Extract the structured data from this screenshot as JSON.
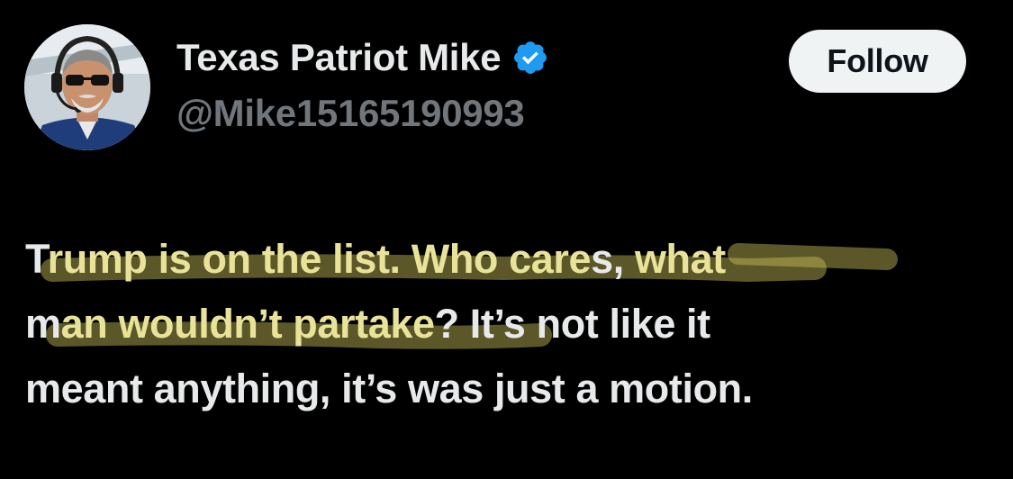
{
  "author": {
    "display_name": "Texas Patriot Mike",
    "handle": "@Mike15165190993",
    "verified_icon": "verified-badge-icon",
    "avatar_icon": "avatar-photo"
  },
  "actions": {
    "follow_label": "Follow"
  },
  "tweet": {
    "line1": {
      "a": "T",
      "b": "rump is on the list.  Who care",
      "c": "s, ",
      "d": "what"
    },
    "line2": {
      "a": "m",
      "b": "an wouldn’t partake",
      "c": "?  It’s not like it"
    },
    "line3": "meant anything, it’s was just a motion."
  },
  "colors": {
    "background": "#000000",
    "primary_text": "#e7e9ea",
    "secondary_text": "#71767b",
    "verified_blue": "#1d9bf0",
    "follow_bg": "#eff3f4",
    "highlight_marker": "#c9c25a"
  }
}
